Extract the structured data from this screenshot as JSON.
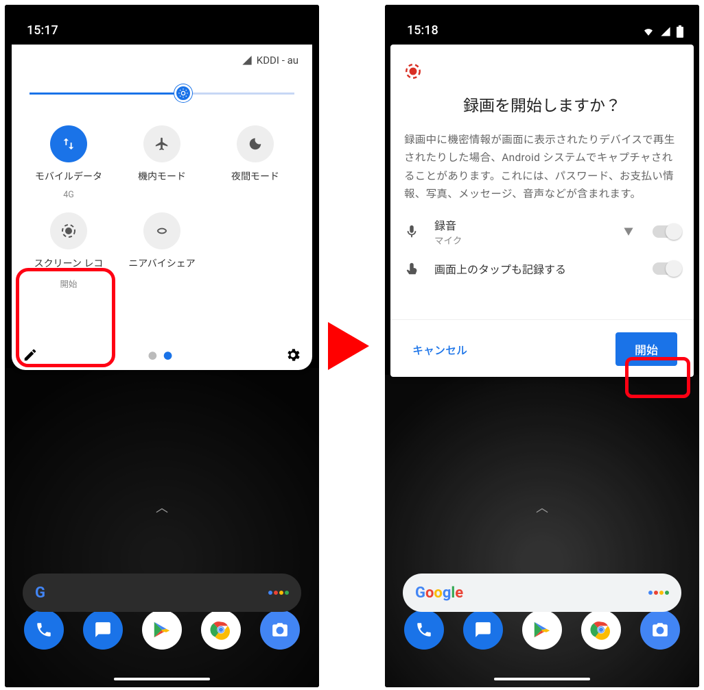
{
  "left": {
    "time": "15:17",
    "carrier": "KDDI - au",
    "tiles": [
      {
        "id": "mobile-data",
        "icon": "swap",
        "label": "モバイルデータ",
        "sub": "4G",
        "active": true
      },
      {
        "id": "airplane",
        "icon": "airplane",
        "label": "機内モード",
        "sub": "",
        "active": false
      },
      {
        "id": "night",
        "icon": "moon",
        "label": "夜間モード",
        "sub": "",
        "active": false
      },
      {
        "id": "screen-rec",
        "icon": "rec",
        "label": "スクリーン レコ",
        "sub": "開始",
        "active": false
      },
      {
        "id": "nearby",
        "icon": "nearby",
        "label": "ニアバイシェア",
        "sub": "",
        "active": false
      }
    ]
  },
  "right": {
    "time": "15:18",
    "dialog": {
      "title": "録画を開始しますか？",
      "body": "録画中に機密情報が画面に表示されたりデバイスで再生されたりした場合、Android システムでキャプチャされることがあります。これには、パスワード、お支払い情報、写真、メッセージ、音声などが含まれます。",
      "opt_audio_title": "録音",
      "opt_audio_sub": "マイク",
      "opt_touch": "画面上のタップも記録する",
      "cancel": "キャンセル",
      "start": "開始"
    }
  }
}
